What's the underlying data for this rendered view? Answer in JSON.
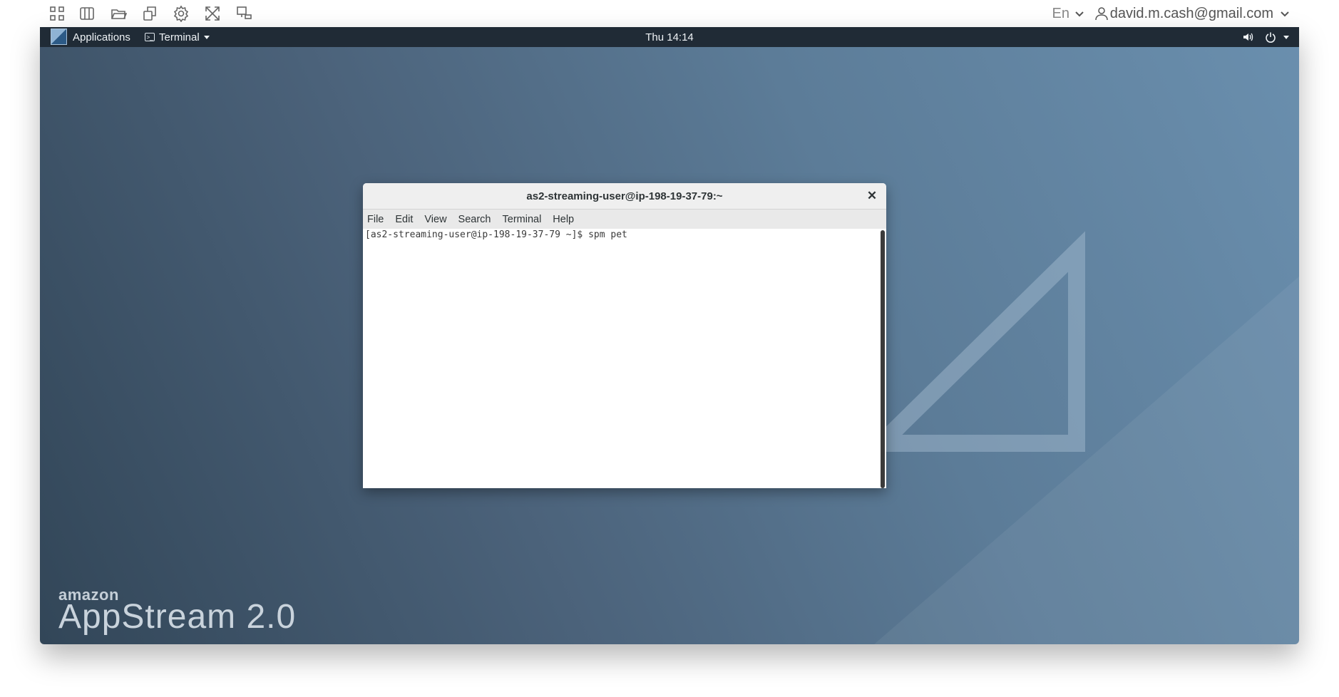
{
  "toolbar": {
    "icons": [
      "apps-grid-icon",
      "split-view-icon",
      "folder-open-icon",
      "copy-files-icon",
      "settings-gear-icon",
      "fullscreen-icon",
      "monitor-icon"
    ],
    "language": "En",
    "user_email": "david.m.cash@gmail.com"
  },
  "gnome_bar": {
    "applications": "Applications",
    "terminal_menu": "Terminal",
    "clock": "Thu 14:14"
  },
  "terminal": {
    "title": "as2-streaming-user@ip-198-19-37-79:~",
    "menu": [
      "File",
      "Edit",
      "View",
      "Search",
      "Terminal",
      "Help"
    ],
    "lines": [
      "[as2-streaming-user@ip-198-19-37-79 ~]$ spm pet"
    ]
  },
  "branding": {
    "small": "amazon",
    "large": "AppStream 2.0"
  },
  "colors": {
    "panel": "#202b36",
    "desktop_dark": "#324658",
    "desktop_light": "#6a8fae"
  }
}
